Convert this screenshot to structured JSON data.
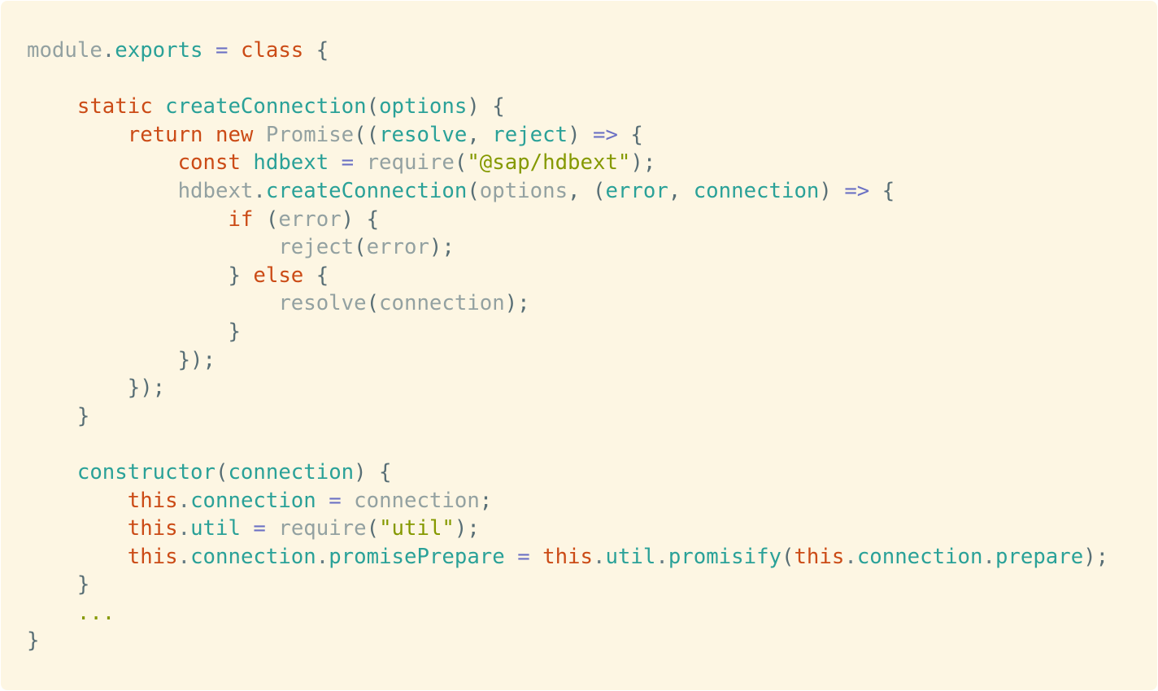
{
  "theme": {
    "background": "#fdf6e3",
    "colors": {
      "plain": "#657b83",
      "ident": "#93a1a1",
      "prop": "#2aa198",
      "kw": "#cb4b16",
      "op": "#6c71c4",
      "str": "#859900",
      "punct": "#586e75"
    }
  },
  "code": {
    "language": "JavaScript",
    "lines": [
      [
        [
          "module",
          "ident"
        ],
        [
          ".",
          "plain"
        ],
        [
          "exports",
          "prop"
        ],
        [
          " ",
          "plain"
        ],
        [
          "=",
          "op"
        ],
        [
          " ",
          "plain"
        ],
        [
          "class",
          "kw"
        ],
        [
          " {",
          "punct"
        ]
      ],
      [],
      [
        [
          "    ",
          "plain"
        ],
        [
          "static",
          "kw"
        ],
        [
          " ",
          "plain"
        ],
        [
          "createConnection",
          "prop"
        ],
        [
          "(",
          "punct"
        ],
        [
          "options",
          "prop"
        ],
        [
          ") {",
          "punct"
        ]
      ],
      [
        [
          "        ",
          "plain"
        ],
        [
          "return",
          "kw"
        ],
        [
          " ",
          "plain"
        ],
        [
          "new",
          "kw"
        ],
        [
          " ",
          "plain"
        ],
        [
          "Promise",
          "ident"
        ],
        [
          "((",
          "punct"
        ],
        [
          "resolve",
          "prop"
        ],
        [
          ", ",
          "punct"
        ],
        [
          "reject",
          "prop"
        ],
        [
          ") ",
          "punct"
        ],
        [
          "=>",
          "op"
        ],
        [
          " {",
          "punct"
        ]
      ],
      [
        [
          "            ",
          "plain"
        ],
        [
          "const",
          "kw"
        ],
        [
          " ",
          "plain"
        ],
        [
          "hdbext",
          "prop"
        ],
        [
          " ",
          "plain"
        ],
        [
          "=",
          "op"
        ],
        [
          " ",
          "plain"
        ],
        [
          "require",
          "ident"
        ],
        [
          "(",
          "punct"
        ],
        [
          "\"@sap/hdbext\"",
          "str"
        ],
        [
          ");",
          "punct"
        ]
      ],
      [
        [
          "            ",
          "plain"
        ],
        [
          "hdbext",
          "ident"
        ],
        [
          ".",
          "plain"
        ],
        [
          "createConnection",
          "prop"
        ],
        [
          "(",
          "punct"
        ],
        [
          "options",
          "ident"
        ],
        [
          ", (",
          "punct"
        ],
        [
          "error",
          "prop"
        ],
        [
          ", ",
          "punct"
        ],
        [
          "connection",
          "prop"
        ],
        [
          ") ",
          "punct"
        ],
        [
          "=>",
          "op"
        ],
        [
          " {",
          "punct"
        ]
      ],
      [
        [
          "                ",
          "plain"
        ],
        [
          "if",
          "kw"
        ],
        [
          " (",
          "punct"
        ],
        [
          "error",
          "ident"
        ],
        [
          ") {",
          "punct"
        ]
      ],
      [
        [
          "                    ",
          "plain"
        ],
        [
          "reject",
          "ident"
        ],
        [
          "(",
          "punct"
        ],
        [
          "error",
          "ident"
        ],
        [
          ");",
          "punct"
        ]
      ],
      [
        [
          "                ",
          "plain"
        ],
        [
          "}",
          "punct"
        ],
        [
          " ",
          "plain"
        ],
        [
          "else",
          "kw"
        ],
        [
          " {",
          "punct"
        ]
      ],
      [
        [
          "                    ",
          "plain"
        ],
        [
          "resolve",
          "ident"
        ],
        [
          "(",
          "punct"
        ],
        [
          "connection",
          "ident"
        ],
        [
          ");",
          "punct"
        ]
      ],
      [
        [
          "                ",
          "plain"
        ],
        [
          "}",
          "punct"
        ]
      ],
      [
        [
          "            ",
          "plain"
        ],
        [
          "});",
          "punct"
        ]
      ],
      [
        [
          "        ",
          "plain"
        ],
        [
          "});",
          "punct"
        ]
      ],
      [
        [
          "    ",
          "plain"
        ],
        [
          "}",
          "punct"
        ]
      ],
      [],
      [
        [
          "    ",
          "plain"
        ],
        [
          "constructor",
          "prop"
        ],
        [
          "(",
          "punct"
        ],
        [
          "connection",
          "prop"
        ],
        [
          ") {",
          "punct"
        ]
      ],
      [
        [
          "        ",
          "plain"
        ],
        [
          "this",
          "kw"
        ],
        [
          ".",
          "plain"
        ],
        [
          "connection",
          "prop"
        ],
        [
          " ",
          "plain"
        ],
        [
          "=",
          "op"
        ],
        [
          " ",
          "plain"
        ],
        [
          "connection",
          "ident"
        ],
        [
          ";",
          "punct"
        ]
      ],
      [
        [
          "        ",
          "plain"
        ],
        [
          "this",
          "kw"
        ],
        [
          ".",
          "plain"
        ],
        [
          "util",
          "prop"
        ],
        [
          " ",
          "plain"
        ],
        [
          "=",
          "op"
        ],
        [
          " ",
          "plain"
        ],
        [
          "require",
          "ident"
        ],
        [
          "(",
          "punct"
        ],
        [
          "\"util\"",
          "str"
        ],
        [
          ");",
          "punct"
        ]
      ],
      [
        [
          "        ",
          "plain"
        ],
        [
          "this",
          "kw"
        ],
        [
          ".",
          "plain"
        ],
        [
          "connection",
          "prop"
        ],
        [
          ".",
          "plain"
        ],
        [
          "promisePrepare",
          "prop"
        ],
        [
          " ",
          "plain"
        ],
        [
          "=",
          "op"
        ],
        [
          " ",
          "plain"
        ],
        [
          "this",
          "kw"
        ],
        [
          ".",
          "plain"
        ],
        [
          "util",
          "prop"
        ],
        [
          ".",
          "plain"
        ],
        [
          "promisify",
          "prop"
        ],
        [
          "(",
          "punct"
        ],
        [
          "this",
          "kw"
        ],
        [
          ".",
          "plain"
        ],
        [
          "connection",
          "prop"
        ],
        [
          ".",
          "plain"
        ],
        [
          "prepare",
          "prop"
        ],
        [
          ");",
          "punct"
        ]
      ],
      [
        [
          "    ",
          "plain"
        ],
        [
          "}",
          "punct"
        ]
      ],
      [
        [
          "    ",
          "plain"
        ],
        [
          "...",
          "str"
        ]
      ],
      [
        [
          "}",
          "punct"
        ]
      ]
    ]
  }
}
